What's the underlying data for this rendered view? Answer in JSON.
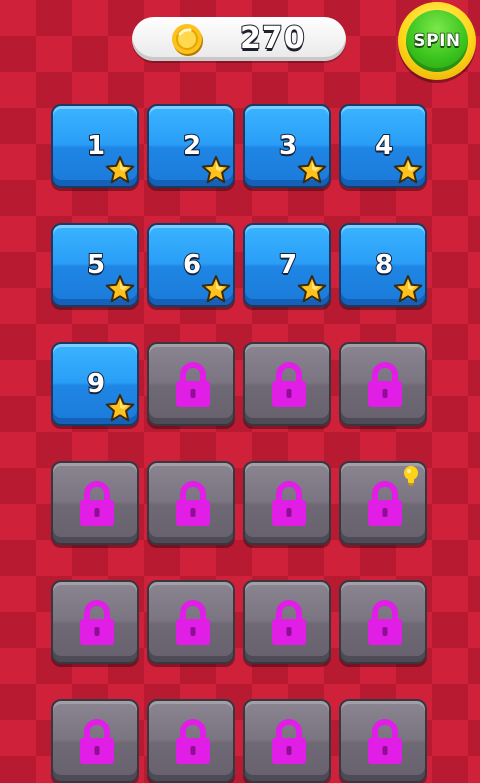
{
  "header": {
    "coin_count": "270",
    "spin_label": "SPIN"
  },
  "levels": [
    {
      "number": "1",
      "locked": false,
      "stars": 1
    },
    {
      "number": "2",
      "locked": false,
      "stars": 1
    },
    {
      "number": "3",
      "locked": false,
      "stars": 1
    },
    {
      "number": "4",
      "locked": false,
      "stars": 1
    },
    {
      "number": "5",
      "locked": false,
      "stars": 1
    },
    {
      "number": "6",
      "locked": false,
      "stars": 1
    },
    {
      "number": "7",
      "locked": false,
      "stars": 1
    },
    {
      "number": "8",
      "locked": false,
      "stars": 1
    },
    {
      "number": "9",
      "locked": false,
      "stars": 1
    },
    {
      "locked": true
    },
    {
      "locked": true
    },
    {
      "locked": true
    },
    {
      "locked": true
    },
    {
      "locked": true
    },
    {
      "locked": true
    },
    {
      "locked": true,
      "hint": true
    },
    {
      "locked": true
    },
    {
      "locked": true
    },
    {
      "locked": true
    },
    {
      "locked": true
    },
    {
      "locked": true
    },
    {
      "locked": true
    },
    {
      "locked": true
    },
    {
      "locked": true
    }
  ],
  "icons": {
    "coin": "gold-coin-icon",
    "star": "star-icon",
    "lock": "padlock-icon",
    "hint": "lightbulb-icon"
  },
  "colors": {
    "background": "#d0213a",
    "unlocked_tile": "#2a9ef7",
    "locked_tile": "#7a7580",
    "lock": "#e01ee6",
    "star": "#ffc21a",
    "spin_button": "#3cc41e"
  }
}
